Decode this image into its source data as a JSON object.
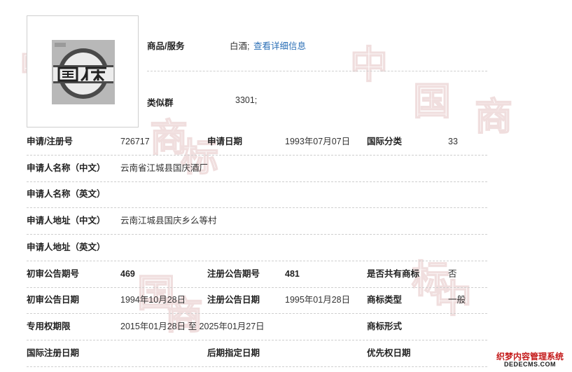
{
  "top": {
    "goods_label": "商品/服务",
    "goods_value": "白酒;",
    "detail_link": "查看详细信息",
    "group_label": "类似群",
    "group_value": "3301;"
  },
  "rows": [
    [
      {
        "t": "lbl",
        "v": "申请/注册号"
      },
      {
        "t": "val",
        "v": "726717"
      },
      {
        "t": "lbl",
        "v": "申请日期"
      },
      {
        "t": "val",
        "v": "1993年07月07日"
      },
      {
        "t": "lbl",
        "v": "国际分类"
      },
      {
        "t": "val",
        "v": "33"
      }
    ],
    [
      {
        "t": "lbl",
        "v": "申请人名称（中文）"
      },
      {
        "t": "val",
        "v": "云南省江城县国庆酒厂"
      }
    ],
    [
      {
        "t": "lbl",
        "v": "申请人名称（英文）"
      }
    ],
    [
      {
        "t": "lbl",
        "v": "申请人地址（中文）"
      },
      {
        "t": "val",
        "v": "云南江城县国庆乡么等村"
      }
    ],
    [
      {
        "t": "lbl",
        "v": "申请人地址（英文）"
      }
    ],
    [
      {
        "t": "lbl",
        "v": "初审公告期号"
      },
      {
        "t": "bold",
        "v": "469"
      },
      {
        "t": "lbl",
        "v": "注册公告期号"
      },
      {
        "t": "bold",
        "v": "481"
      },
      {
        "t": "lbl",
        "v": "是否共有商标"
      },
      {
        "t": "val",
        "v": "否"
      }
    ],
    [
      {
        "t": "lbl",
        "v": "初审公告日期"
      },
      {
        "t": "val",
        "v": "1994年10月28日"
      },
      {
        "t": "lbl",
        "v": "注册公告日期"
      },
      {
        "t": "val",
        "v": "1995年01月28日"
      },
      {
        "t": "lbl",
        "v": "商标类型"
      },
      {
        "t": "val",
        "v": "一般"
      }
    ],
    [
      {
        "t": "lbl",
        "v": "专用权期限"
      },
      {
        "t": "val",
        "v": "2015年01月28日 至 2025年01月27日"
      },
      {
        "t": "lbl",
        "v": "商标形式"
      }
    ],
    [
      {
        "t": "lbl",
        "v": "国际注册日期"
      },
      {
        "t": "lbl",
        "v": "后期指定日期"
      },
      {
        "t": "lbl",
        "v": "优先权日期"
      }
    ]
  ],
  "watermark": {
    "chars": [
      "中",
      "国",
      "商",
      "标",
      "中",
      "国",
      "商",
      "标"
    ]
  },
  "corner_badge": {
    "line1": "织梦内容管理系统",
    "line2": "DEDECMS.COM"
  },
  "colors": {
    "link": "#2b6fb6",
    "label": "#222222",
    "divider": "#cfcfcf",
    "watermark": "#f0dede"
  }
}
